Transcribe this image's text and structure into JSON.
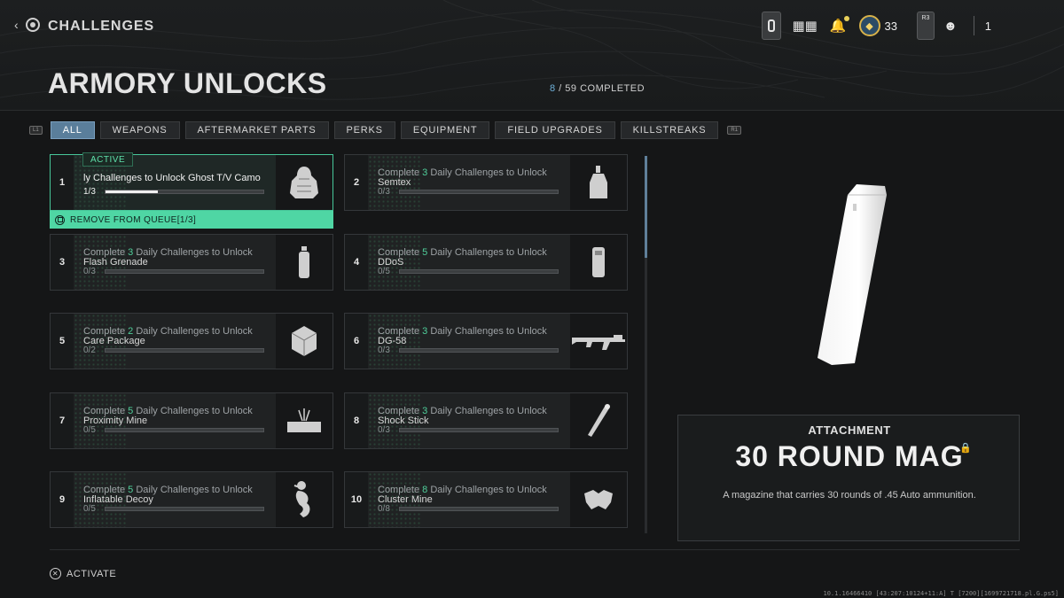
{
  "header": {
    "breadcrumb": "CHALLENGES",
    "title": "ARMORY UNLOCKS",
    "completed_count": "8",
    "completed_rest": " / 59 COMPLETED"
  },
  "hud": {
    "currency_count": "33",
    "r3_label": "R3",
    "party_count": "1"
  },
  "tabs": {
    "left_bumper": "L1",
    "right_bumper": "R1",
    "items": [
      "ALL",
      "WEAPONS",
      "AFTERMARKET PARTS",
      "PERKS",
      "EQUIPMENT",
      "FIELD UPGRADES",
      "KILLSTREAKS"
    ]
  },
  "active_badge": "ACTIVE",
  "remove_queue": "REMOVE FROM QUEUE[1/3]",
  "challenges": [
    {
      "index": "1",
      "active": true,
      "text": "ly Challenges to Unlock Ghost T/V Camo",
      "progress": "1/3",
      "fraction": 0.333,
      "icon": "ghost-camo-icon"
    },
    {
      "index": "2",
      "prefix": "Complete ",
      "count": "3",
      "mid": " Daily Challenges to Unlock",
      "item": "Semtex",
      "progress": "0/3",
      "fraction": 0,
      "icon": "semtex-icon"
    },
    {
      "index": "3",
      "prefix": "Complete ",
      "count": "3",
      "mid": " Daily Challenges to Unlock",
      "item": "Flash Grenade",
      "progress": "0/3",
      "fraction": 0,
      "icon": "flash-grenade-icon"
    },
    {
      "index": "4",
      "prefix": "Complete ",
      "count": "5",
      "mid": " Daily Challenges to Unlock",
      "item": "DDoS",
      "progress": "0/5",
      "fraction": 0,
      "icon": "ddos-icon"
    },
    {
      "index": "5",
      "prefix": "Complete ",
      "count": "2",
      "mid": " Daily Challenges to Unlock",
      "item": "Care Package",
      "progress": "0/2",
      "fraction": 0,
      "icon": "care-package-icon"
    },
    {
      "index": "6",
      "prefix": "Complete ",
      "count": "3",
      "mid": " Daily Challenges to Unlock",
      "item": "DG-58",
      "progress": "0/3",
      "fraction": 0,
      "icon": "rifle-icon"
    },
    {
      "index": "7",
      "prefix": "Complete ",
      "count": "5",
      "mid": " Daily Challenges to Unlock",
      "item": "Proximity Mine",
      "progress": "0/5",
      "fraction": 0,
      "icon": "proximity-mine-icon"
    },
    {
      "index": "8",
      "prefix": "Complete ",
      "count": "3",
      "mid": " Daily Challenges to Unlock",
      "item": "Shock Stick",
      "progress": "0/3",
      "fraction": 0,
      "icon": "shock-stick-icon"
    },
    {
      "index": "9",
      "prefix": "Complete ",
      "count": "5",
      "mid": " Daily Challenges to Unlock",
      "item": "Inflatable Decoy",
      "progress": "0/5",
      "fraction": 0,
      "icon": "inflatable-decoy-icon"
    },
    {
      "index": "10",
      "prefix": "Complete ",
      "count": "8",
      "mid": " Daily Challenges to Unlock",
      "item": "Cluster Mine",
      "progress": "0/8",
      "fraction": 0,
      "icon": "cluster-mine-icon"
    }
  ],
  "detail": {
    "category": "ATTACHMENT",
    "name": "30 ROUND MAG",
    "description": "A magazine that carries 30 rounds of .45 Auto ammunition."
  },
  "footer": {
    "activate": "ACTIVATE",
    "build": "10.1.16466410 [43:207:10124+11:A] T [7200][1699721718.pl.G.ps5]"
  },
  "colors": {
    "accent": "#4fd6a4",
    "tab_active": "#5a7e9b",
    "highlight_number": "#4fce9a"
  }
}
